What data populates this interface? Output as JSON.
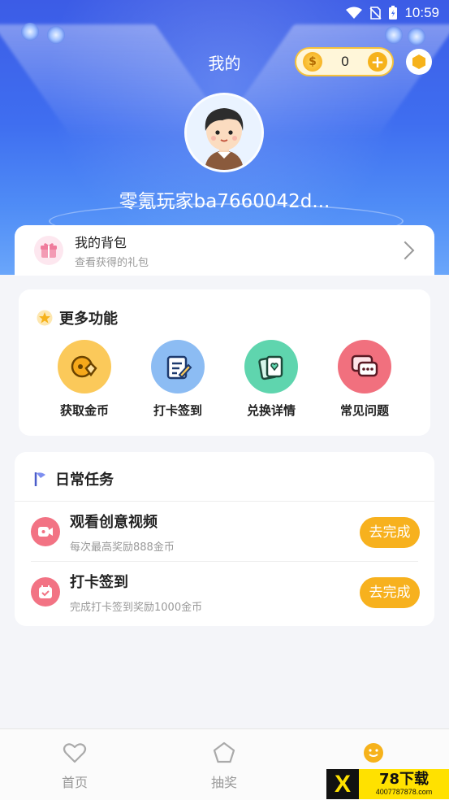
{
  "status_bar": {
    "time": "10:59"
  },
  "header": {
    "title": "我的",
    "coins": {
      "count": "0"
    },
    "username": "零氪玩家ba7660042d..."
  },
  "backpack": {
    "title": "我的背包",
    "subtitle": "查看获得的礼包"
  },
  "more_features": {
    "title": "更多功能",
    "items": [
      {
        "label": "获取金币",
        "icon": "coin-hand-icon",
        "color": "#fbc95a"
      },
      {
        "label": "打卡签到",
        "icon": "checkin-icon",
        "color": "#8cbcf3"
      },
      {
        "label": "兑换详情",
        "icon": "cards-icon",
        "color": "#5fd5ae"
      },
      {
        "label": "常见问题",
        "icon": "chat-icon",
        "color": "#f1707e"
      }
    ]
  },
  "daily_tasks": {
    "title": "日常任务",
    "tasks": [
      {
        "title": "观看创意视频",
        "subtitle": "每次最高奖励888金币",
        "button": "去完成",
        "icon": "video-icon"
      },
      {
        "title": "打卡签到",
        "subtitle": "完成打卡签到奖励1000金币",
        "button": "去完成",
        "icon": "calendar-icon"
      }
    ]
  },
  "bottom_nav": {
    "items": [
      {
        "label": "首页",
        "icon": "heart-icon"
      },
      {
        "label": "抽奖",
        "icon": "pentagon-icon"
      },
      {
        "label": "",
        "icon": "smile-icon"
      }
    ]
  },
  "watermark": {
    "main": "78下载",
    "url": "4007787878.com",
    "x": "X"
  },
  "colors": {
    "accent": "#f7b11e",
    "header": "#3f6ef0",
    "task_icon": "#f27384"
  }
}
